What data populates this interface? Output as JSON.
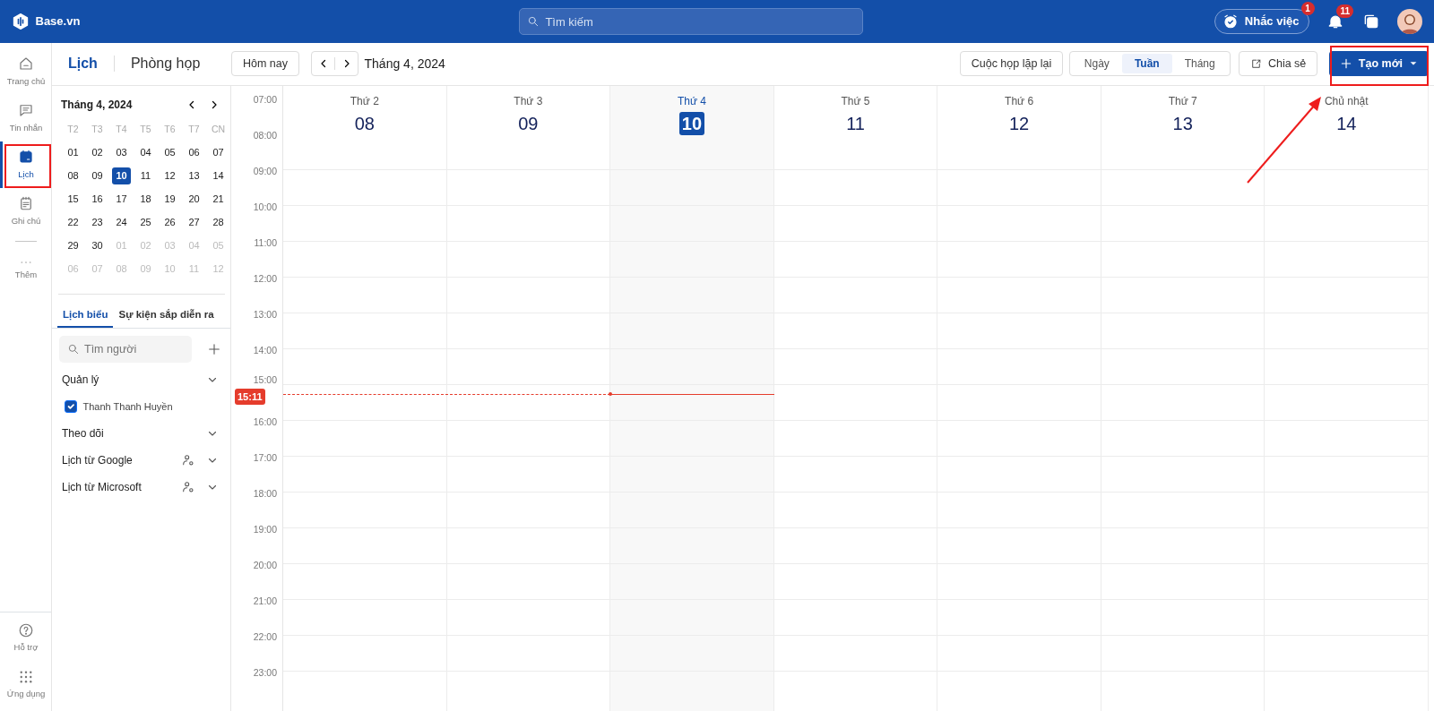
{
  "topbar": {
    "logo": "Base.vn",
    "search": {
      "placeholder": "Tìm kiếm"
    },
    "reminder": {
      "label": "Nhắc việc",
      "badge": "1"
    },
    "notifications": {
      "badge": "11"
    }
  },
  "rail": {
    "items": [
      {
        "label": "Trang chủ",
        "selected": false
      },
      {
        "label": "Tin nhắn",
        "selected": false
      },
      {
        "label": "Lịch",
        "selected": true
      },
      {
        "label": "Ghi chú",
        "selected": false
      },
      {
        "label": "Thêm",
        "selected": false
      }
    ],
    "bottom": [
      {
        "label": "Hỗ trợ",
        "selected": false
      },
      {
        "label": "Ứng dụng",
        "selected": false
      }
    ]
  },
  "header": {
    "tabs": [
      {
        "label": "Lịch",
        "selected": true
      },
      {
        "label": "Phòng họp",
        "selected": false
      }
    ],
    "today_button": "Hôm nay",
    "period": "Tháng 4, 2024",
    "recurring_button": "Cuộc họp lặp lại",
    "views": [
      {
        "label": "Ngày",
        "selected": false
      },
      {
        "label": "Tuần",
        "selected": true
      },
      {
        "label": "Tháng",
        "selected": false
      }
    ],
    "share_button": "Chia sẻ",
    "create_button": "Tạo mới"
  },
  "mini_calendar": {
    "title": "Tháng 4, 2024",
    "weekdays": [
      "T2",
      "T3",
      "T4",
      "T5",
      "T6",
      "T7",
      "CN"
    ],
    "weeks": [
      [
        {
          "label": "01",
          "muted": false,
          "selected": false
        },
        {
          "label": "02",
          "muted": false,
          "selected": false
        },
        {
          "label": "03",
          "muted": false,
          "selected": false
        },
        {
          "label": "04",
          "muted": false,
          "selected": false
        },
        {
          "label": "05",
          "muted": false,
          "selected": false
        },
        {
          "label": "06",
          "muted": false,
          "selected": false
        },
        {
          "label": "07",
          "muted": false,
          "selected": false
        }
      ],
      [
        {
          "label": "08",
          "muted": false,
          "selected": false
        },
        {
          "label": "09",
          "muted": false,
          "selected": false
        },
        {
          "label": "10",
          "muted": false,
          "selected": true
        },
        {
          "label": "11",
          "muted": false,
          "selected": false
        },
        {
          "label": "12",
          "muted": false,
          "selected": false
        },
        {
          "label": "13",
          "muted": false,
          "selected": false
        },
        {
          "label": "14",
          "muted": false,
          "selected": false
        }
      ],
      [
        {
          "label": "15",
          "muted": false,
          "selected": false
        },
        {
          "label": "16",
          "muted": false,
          "selected": false
        },
        {
          "label": "17",
          "muted": false,
          "selected": false
        },
        {
          "label": "18",
          "muted": false,
          "selected": false
        },
        {
          "label": "19",
          "muted": false,
          "selected": false
        },
        {
          "label": "20",
          "muted": false,
          "selected": false
        },
        {
          "label": "21",
          "muted": false,
          "selected": false
        }
      ],
      [
        {
          "label": "22",
          "muted": false,
          "selected": false
        },
        {
          "label": "23",
          "muted": false,
          "selected": false
        },
        {
          "label": "24",
          "muted": false,
          "selected": false
        },
        {
          "label": "25",
          "muted": false,
          "selected": false
        },
        {
          "label": "26",
          "muted": false,
          "selected": false
        },
        {
          "label": "27",
          "muted": false,
          "selected": false
        },
        {
          "label": "28",
          "muted": false,
          "selected": false
        }
      ],
      [
        {
          "label": "29",
          "muted": false,
          "selected": false
        },
        {
          "label": "30",
          "muted": false,
          "selected": false
        },
        {
          "label": "01",
          "muted": true,
          "selected": false
        },
        {
          "label": "02",
          "muted": true,
          "selected": false
        },
        {
          "label": "03",
          "muted": true,
          "selected": false
        },
        {
          "label": "04",
          "muted": true,
          "selected": false
        },
        {
          "label": "05",
          "muted": true,
          "selected": false
        }
      ],
      [
        {
          "label": "06",
          "muted": true,
          "selected": false
        },
        {
          "label": "07",
          "muted": true,
          "selected": false
        },
        {
          "label": "08",
          "muted": true,
          "selected": false
        },
        {
          "label": "09",
          "muted": true,
          "selected": false
        },
        {
          "label": "10",
          "muted": true,
          "selected": false
        },
        {
          "label": "11",
          "muted": true,
          "selected": false
        },
        {
          "label": "12",
          "muted": true,
          "selected": false
        }
      ]
    ]
  },
  "panel_tabs": [
    {
      "label": "Lịch biểu",
      "selected": true
    },
    {
      "label": "Sự kiện sắp diễn ra",
      "selected": false
    }
  ],
  "people_search": {
    "placeholder": "Tìm người"
  },
  "groups": [
    {
      "label": "Quản lý",
      "kind": "plain",
      "children": [
        {
          "name": "Thanh Thanh Huyền",
          "checked": true
        }
      ]
    },
    {
      "label": "Theo dõi",
      "kind": "plain"
    },
    {
      "label": "Lịch từ Google",
      "kind": "linked"
    },
    {
      "label": "Lịch từ Microsoft",
      "kind": "linked"
    }
  ],
  "week": {
    "days": [
      {
        "weekday": "Thứ 2",
        "date": "08",
        "today": false
      },
      {
        "weekday": "Thứ 3",
        "date": "09",
        "today": false
      },
      {
        "weekday": "Thứ 4",
        "date": "10",
        "today": true
      },
      {
        "weekday": "Thứ 5",
        "date": "11",
        "today": false
      },
      {
        "weekday": "Thứ 6",
        "date": "12",
        "today": false
      },
      {
        "weekday": "Thứ 7",
        "date": "13",
        "today": false
      },
      {
        "weekday": "Chủ nhật",
        "date": "14",
        "today": false
      }
    ],
    "hours": [
      "07:00",
      "08:00",
      "09:00",
      "10:00",
      "11:00",
      "12:00",
      "13:00",
      "14:00",
      "15:00",
      "16:00",
      "17:00",
      "18:00",
      "19:00",
      "20:00",
      "21:00",
      "22:00",
      "23:00"
    ],
    "now": "15:11"
  }
}
